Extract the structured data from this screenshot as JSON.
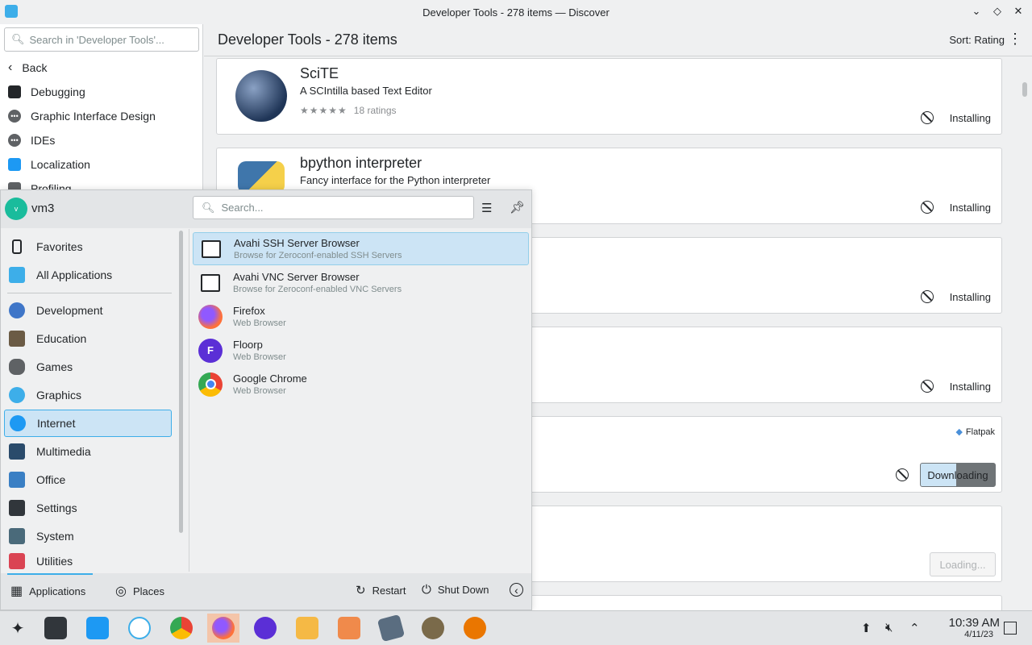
{
  "window": {
    "title": "Developer Tools - 278 items — Discover",
    "controls": [
      "⌄",
      "◇",
      "✕"
    ]
  },
  "sidebar": {
    "search_placeholder": "Search in 'Developer Tools'...",
    "items": [
      {
        "label": "Back",
        "icon": "back-icon"
      },
      {
        "label": "Debugging",
        "icon": "debugging-icon"
      },
      {
        "label": "Graphic Interface Design",
        "icon": "more-icon"
      },
      {
        "label": "IDEs",
        "icon": "more-icon"
      },
      {
        "label": "Localization",
        "icon": "localization-icon"
      },
      {
        "label": "Profiling",
        "icon": "profiling-icon"
      }
    ]
  },
  "main": {
    "header_title": "Developer Tools - 278 items",
    "sort_label": "Sort: Rating",
    "cards": [
      {
        "name": "SciTE",
        "description": "A SCIntilla based Text Editor",
        "stars": "★★★★★",
        "ratings": "18 ratings",
        "status": "Installing"
      },
      {
        "name": "bpython interpreter",
        "description": "Fancy interface for the Python interpreter",
        "status": "Installing"
      },
      {
        "status": "Installing"
      },
      {
        "status": "Installing"
      },
      {
        "badge": "Flatpak",
        "button": "Downloading"
      },
      {
        "button": "Loading..."
      }
    ]
  },
  "launcher": {
    "username": "vm3",
    "avatar_letter": "v",
    "search_placeholder": "Search...",
    "categories": [
      {
        "label": "Favorites",
        "color": "#232629"
      },
      {
        "label": "All Applications",
        "color": "#3daee9"
      },
      {
        "label": "Development",
        "color": "#3f76c8"
      },
      {
        "label": "Education",
        "color": "#6b5b45"
      },
      {
        "label": "Games",
        "color": "#5f6265"
      },
      {
        "label": "Graphics",
        "color": "#3daee9"
      },
      {
        "label": "Internet",
        "color": "#1d99f3"
      },
      {
        "label": "Multimedia",
        "color": "#2a4b6b"
      },
      {
        "label": "Office",
        "color": "#3a7fc4"
      },
      {
        "label": "Settings",
        "color": "#31363b"
      },
      {
        "label": "System",
        "color": "#4a6a7a"
      },
      {
        "label": "Utilities",
        "color": "#da4453"
      }
    ],
    "apps": [
      {
        "name": "Avahi SSH Server Browser",
        "subtitle": "Browse for Zeroconf-enabled SSH Servers"
      },
      {
        "name": "Avahi VNC Server Browser",
        "subtitle": "Browse for Zeroconf-enabled VNC Servers"
      },
      {
        "name": "Firefox",
        "subtitle": "Web Browser"
      },
      {
        "name": "Floorp",
        "subtitle": "Web Browser"
      },
      {
        "name": "Google Chrome",
        "subtitle": "Web Browser"
      }
    ],
    "footer": {
      "applications": "Applications",
      "places": "Places",
      "restart": "Restart",
      "shutdown": "Shut Down"
    }
  },
  "taskbar": {
    "time": "10:39 AM",
    "date": "4/11/23",
    "apps": [
      "kickoff",
      "system-settings",
      "discover",
      "kde-connect",
      "chrome",
      "firefox",
      "floorp",
      "files-1",
      "files-2",
      "text-editor",
      "gimp",
      "blender"
    ]
  }
}
